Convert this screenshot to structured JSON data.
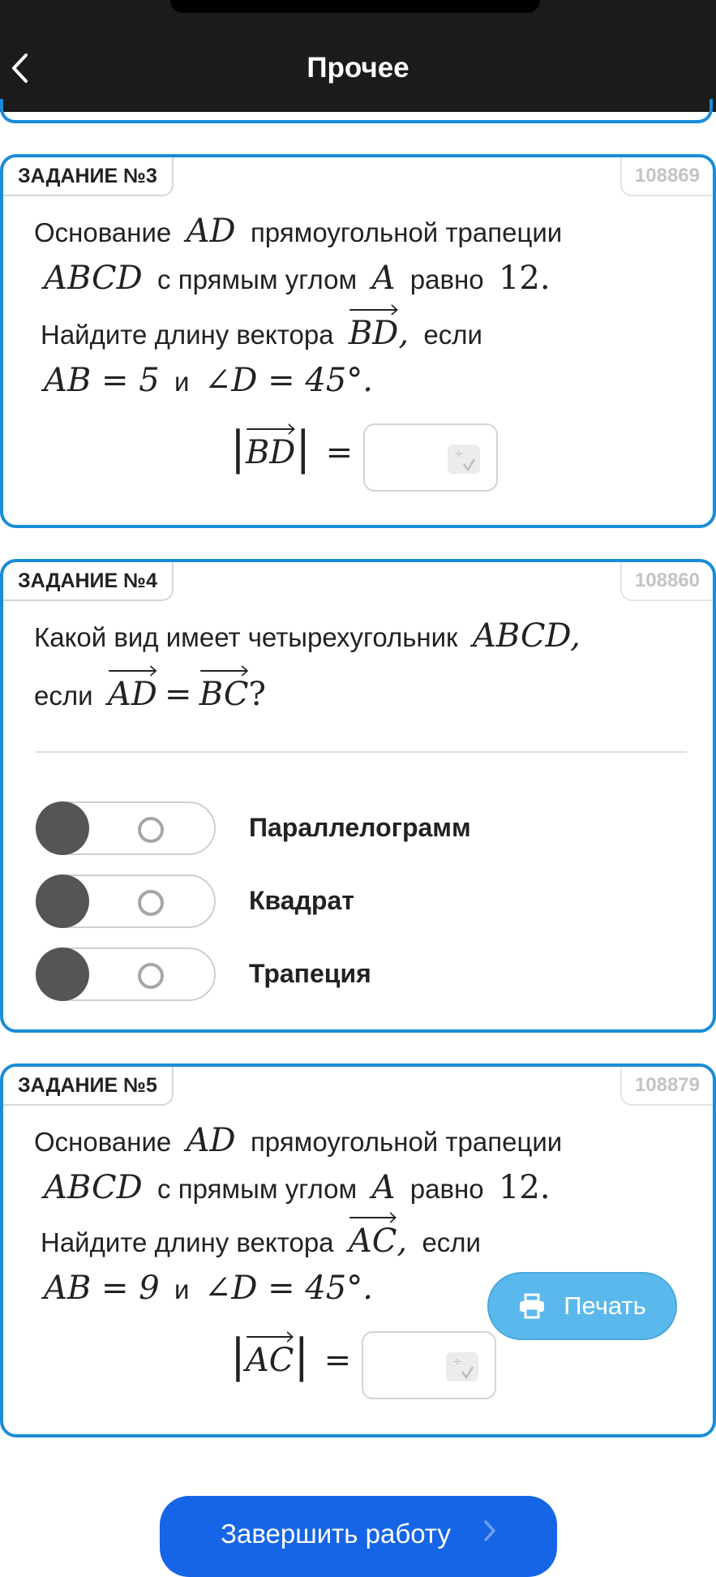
{
  "header": {
    "title": "Прочее"
  },
  "tasks": [
    {
      "badge": "ЗАДАНИЕ №3",
      "id": "108869",
      "line1": {
        "t1": "Основание",
        "m1": "AD",
        "t2": "прямоугольной трапеции"
      },
      "line2": {
        "m1": "ABCD",
        "t1": "с прямым углом",
        "m2": "A",
        "t2": "равно",
        "m3": "12."
      },
      "line3": {
        "t1": "Найдите длину вектора",
        "v": "BD",
        "t2": ",",
        "t3": "если"
      },
      "line4": {
        "m1": "AB = 5",
        "t1": "и",
        "m2": "∠D = 45°."
      },
      "answer": {
        "vec": "BD",
        "eq": "=",
        "value": ""
      }
    },
    {
      "badge": "ЗАДАНИЕ №4",
      "id": "108860",
      "line1": {
        "t1": "Какой вид имеет четырехугольник",
        "m1": "ABCD",
        "t2": ","
      },
      "line2": {
        "t1": "если",
        "v1": "AD",
        "eq": "=",
        "v2": "BC",
        "q": "?"
      },
      "options": [
        "Параллелограмм",
        "Квадрат",
        "Трапеция"
      ]
    },
    {
      "badge": "ЗАДАНИЕ №5",
      "id": "108879",
      "line1": {
        "t1": "Основание",
        "m1": "AD",
        "t2": "прямоугольной трапеции"
      },
      "line2": {
        "m1": "ABCD",
        "t1": "с прямым углом",
        "m2": "A",
        "t2": "равно",
        "m3": "12."
      },
      "line3": {
        "t1": "Найдите длину вектора",
        "v": "AC",
        "t2": ",",
        "t3": "если"
      },
      "line4": {
        "m1": "AB = 9",
        "t1": "и",
        "m2": "∠D = 45°."
      },
      "answer": {
        "vec": "AC",
        "eq": "=",
        "value": ""
      }
    }
  ],
  "print_button": {
    "label": "Печать",
    "icon": "printer-icon"
  },
  "finish_button": {
    "label": "Завершить работу",
    "icon": "chevron-right-icon"
  },
  "colors": {
    "accent": "#1a8cd8",
    "header_bg": "#1b1b1b",
    "print_bg": "#5bb8ec",
    "finish_bg": "#1565e6"
  }
}
